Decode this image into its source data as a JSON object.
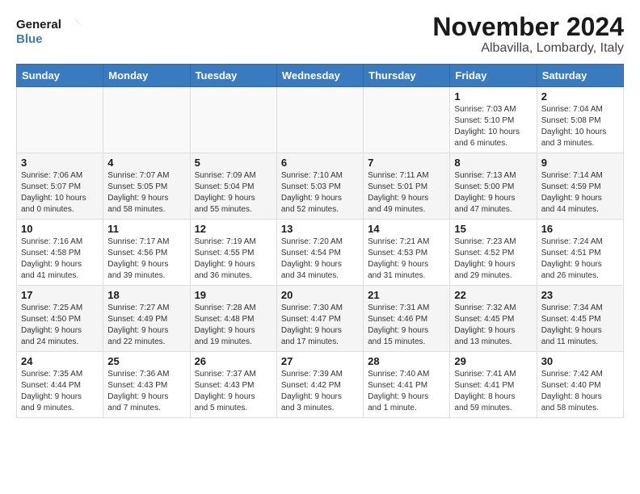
{
  "logo": {
    "line1": "General",
    "line2": "Blue"
  },
  "title": "November 2024",
  "subtitle": "Albavilla, Lombardy, Italy",
  "weekdays": [
    "Sunday",
    "Monday",
    "Tuesday",
    "Wednesday",
    "Thursday",
    "Friday",
    "Saturday"
  ],
  "weeks": [
    [
      {
        "day": "",
        "info": ""
      },
      {
        "day": "",
        "info": ""
      },
      {
        "day": "",
        "info": ""
      },
      {
        "day": "",
        "info": ""
      },
      {
        "day": "",
        "info": ""
      },
      {
        "day": "1",
        "info": "Sunrise: 7:03 AM\nSunset: 5:10 PM\nDaylight: 10 hours\nand 6 minutes."
      },
      {
        "day": "2",
        "info": "Sunrise: 7:04 AM\nSunset: 5:08 PM\nDaylight: 10 hours\nand 3 minutes."
      }
    ],
    [
      {
        "day": "3",
        "info": "Sunrise: 7:06 AM\nSunset: 5:07 PM\nDaylight: 10 hours\nand 0 minutes."
      },
      {
        "day": "4",
        "info": "Sunrise: 7:07 AM\nSunset: 5:05 PM\nDaylight: 9 hours\nand 58 minutes."
      },
      {
        "day": "5",
        "info": "Sunrise: 7:09 AM\nSunset: 5:04 PM\nDaylight: 9 hours\nand 55 minutes."
      },
      {
        "day": "6",
        "info": "Sunrise: 7:10 AM\nSunset: 5:03 PM\nDaylight: 9 hours\nand 52 minutes."
      },
      {
        "day": "7",
        "info": "Sunrise: 7:11 AM\nSunset: 5:01 PM\nDaylight: 9 hours\nand 49 minutes."
      },
      {
        "day": "8",
        "info": "Sunrise: 7:13 AM\nSunset: 5:00 PM\nDaylight: 9 hours\nand 47 minutes."
      },
      {
        "day": "9",
        "info": "Sunrise: 7:14 AM\nSunset: 4:59 PM\nDaylight: 9 hours\nand 44 minutes."
      }
    ],
    [
      {
        "day": "10",
        "info": "Sunrise: 7:16 AM\nSunset: 4:58 PM\nDaylight: 9 hours\nand 41 minutes."
      },
      {
        "day": "11",
        "info": "Sunrise: 7:17 AM\nSunset: 4:56 PM\nDaylight: 9 hours\nand 39 minutes."
      },
      {
        "day": "12",
        "info": "Sunrise: 7:19 AM\nSunset: 4:55 PM\nDaylight: 9 hours\nand 36 minutes."
      },
      {
        "day": "13",
        "info": "Sunrise: 7:20 AM\nSunset: 4:54 PM\nDaylight: 9 hours\nand 34 minutes."
      },
      {
        "day": "14",
        "info": "Sunrise: 7:21 AM\nSunset: 4:53 PM\nDaylight: 9 hours\nand 31 minutes."
      },
      {
        "day": "15",
        "info": "Sunrise: 7:23 AM\nSunset: 4:52 PM\nDaylight: 9 hours\nand 29 minutes."
      },
      {
        "day": "16",
        "info": "Sunrise: 7:24 AM\nSunset: 4:51 PM\nDaylight: 9 hours\nand 26 minutes."
      }
    ],
    [
      {
        "day": "17",
        "info": "Sunrise: 7:25 AM\nSunset: 4:50 PM\nDaylight: 9 hours\nand 24 minutes."
      },
      {
        "day": "18",
        "info": "Sunrise: 7:27 AM\nSunset: 4:49 PM\nDaylight: 9 hours\nand 22 minutes."
      },
      {
        "day": "19",
        "info": "Sunrise: 7:28 AM\nSunset: 4:48 PM\nDaylight: 9 hours\nand 19 minutes."
      },
      {
        "day": "20",
        "info": "Sunrise: 7:30 AM\nSunset: 4:47 PM\nDaylight: 9 hours\nand 17 minutes."
      },
      {
        "day": "21",
        "info": "Sunrise: 7:31 AM\nSunset: 4:46 PM\nDaylight: 9 hours\nand 15 minutes."
      },
      {
        "day": "22",
        "info": "Sunrise: 7:32 AM\nSunset: 4:45 PM\nDaylight: 9 hours\nand 13 minutes."
      },
      {
        "day": "23",
        "info": "Sunrise: 7:34 AM\nSunset: 4:45 PM\nDaylight: 9 hours\nand 11 minutes."
      }
    ],
    [
      {
        "day": "24",
        "info": "Sunrise: 7:35 AM\nSunset: 4:44 PM\nDaylight: 9 hours\nand 9 minutes."
      },
      {
        "day": "25",
        "info": "Sunrise: 7:36 AM\nSunset: 4:43 PM\nDaylight: 9 hours\nand 7 minutes."
      },
      {
        "day": "26",
        "info": "Sunrise: 7:37 AM\nSunset: 4:43 PM\nDaylight: 9 hours\nand 5 minutes."
      },
      {
        "day": "27",
        "info": "Sunrise: 7:39 AM\nSunset: 4:42 PM\nDaylight: 9 hours\nand 3 minutes."
      },
      {
        "day": "28",
        "info": "Sunrise: 7:40 AM\nSunset: 4:41 PM\nDaylight: 9 hours\nand 1 minute."
      },
      {
        "day": "29",
        "info": "Sunrise: 7:41 AM\nSunset: 4:41 PM\nDaylight: 8 hours\nand 59 minutes."
      },
      {
        "day": "30",
        "info": "Sunrise: 7:42 AM\nSunset: 4:40 PM\nDaylight: 8 hours\nand 58 minutes."
      }
    ]
  ]
}
